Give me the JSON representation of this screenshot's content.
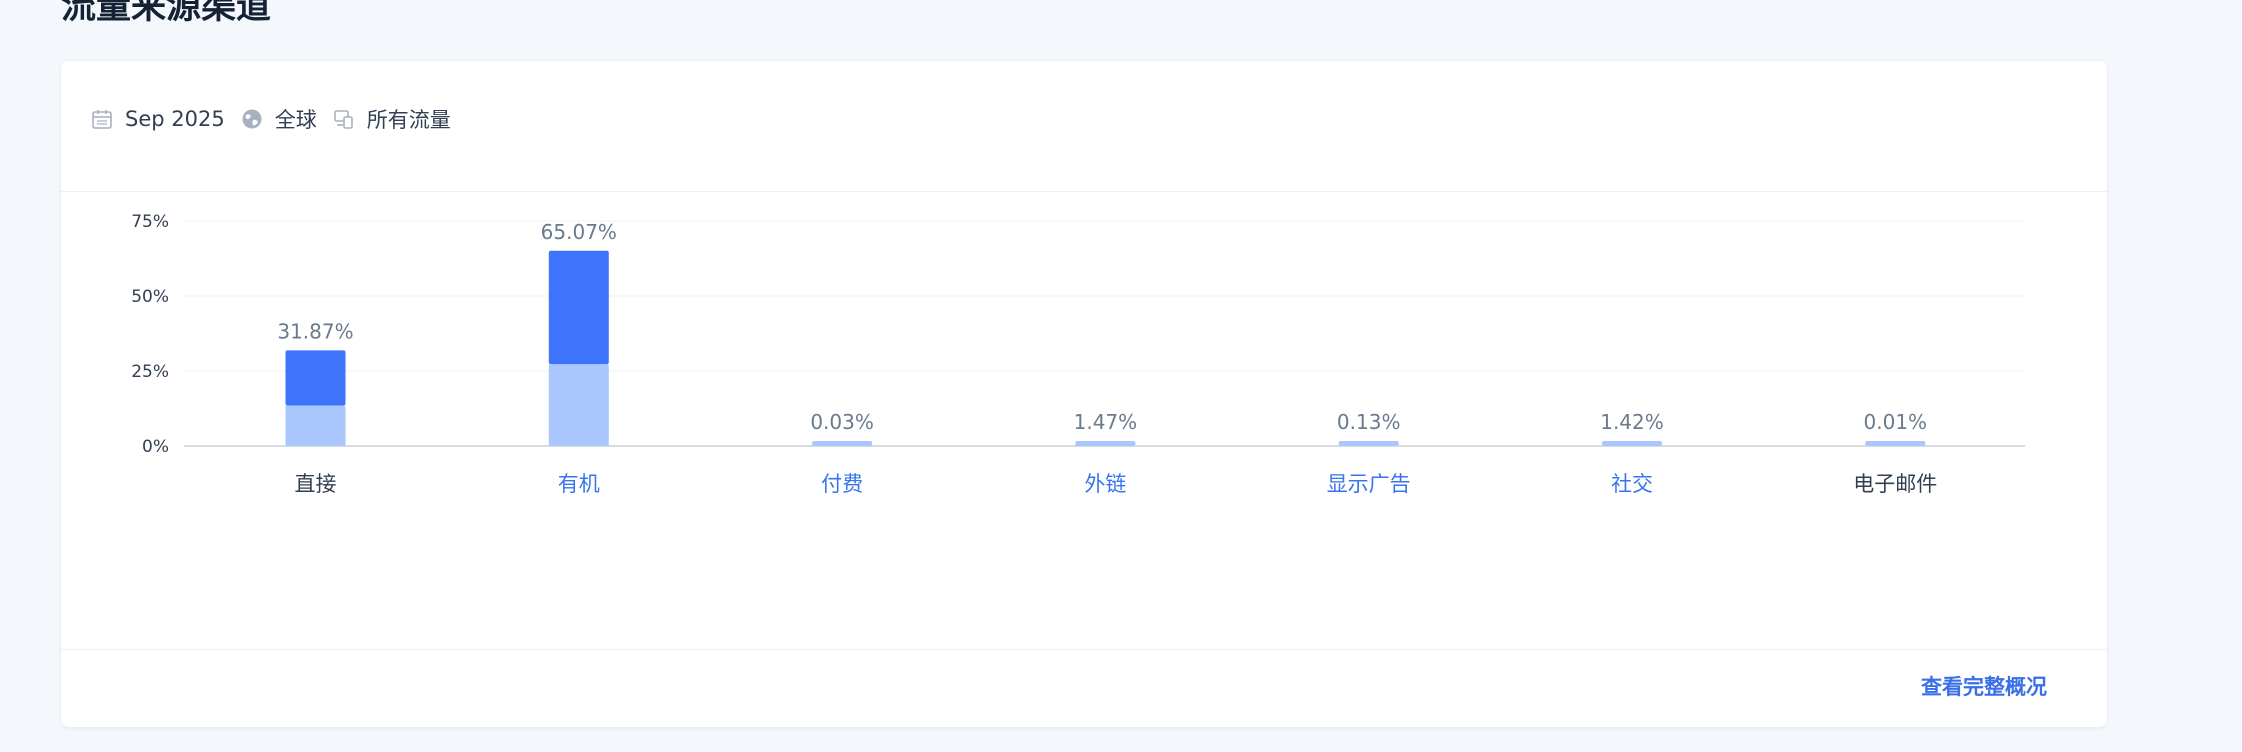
{
  "page_title": "流量来源渠道",
  "filters": {
    "date": "Sep 2025",
    "region": "全球",
    "traffic": "所有流量"
  },
  "footer": {
    "link_label": "查看完整概况"
  },
  "colors": {
    "accent": "#3d74fb",
    "light": "#a9c7fd",
    "link": "#3a6fe8",
    "label_dark": "#323f52"
  },
  "chart_data": {
    "type": "bar",
    "stacked": true,
    "categories": [
      "直接",
      "有机",
      "付费",
      "外链",
      "显示广告",
      "社交",
      "电子邮件"
    ],
    "category_link": [
      false,
      true,
      true,
      true,
      true,
      true,
      false
    ],
    "totals": [
      31.87,
      65.07,
      0.03,
      1.47,
      0.13,
      1.42,
      0.01
    ],
    "total_labels": [
      "31.87%",
      "65.07%",
      "0.03%",
      "1.47%",
      "0.13%",
      "1.42%",
      "0.01%"
    ],
    "series": [
      {
        "color": "#a9c7fd",
        "values": [
          13.5,
          27.3,
          0.03,
          1.47,
          0.13,
          1.42,
          0.01
        ]
      },
      {
        "color": "#3d74fb",
        "values": [
          18.37,
          37.77,
          0,
          0,
          0,
          0,
          0
        ]
      }
    ],
    "y_ticks": [
      0,
      25,
      50,
      75
    ],
    "y_tick_labels": [
      "0%",
      "25%",
      "50%",
      "75%"
    ],
    "ylim": [
      0,
      75
    ],
    "grid": true
  }
}
